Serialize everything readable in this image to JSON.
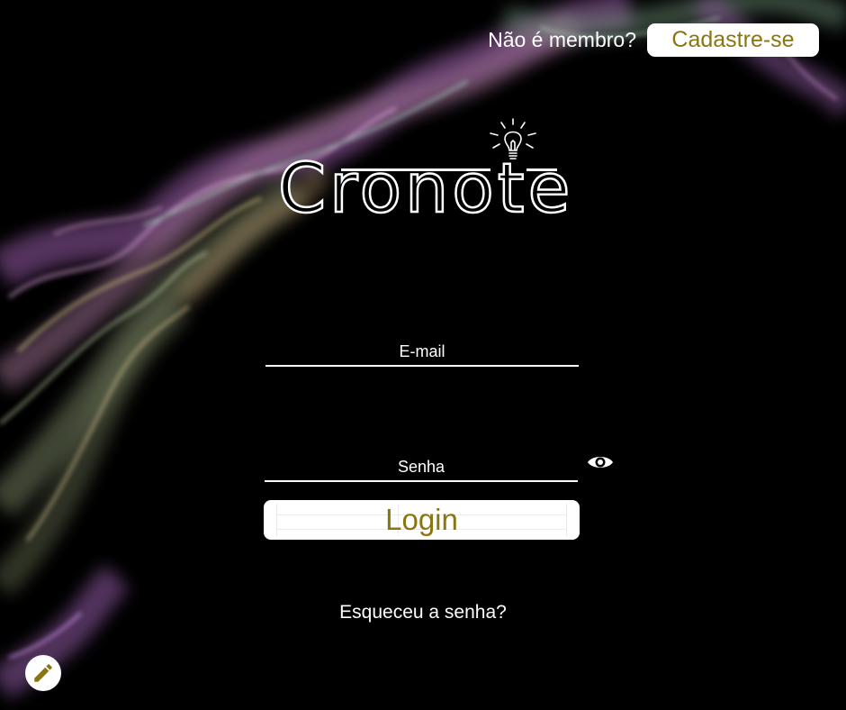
{
  "header": {
    "member_prompt": "Não é membro?",
    "signup_label": "Cadastre-se"
  },
  "logo": {
    "text": "Cronote"
  },
  "form": {
    "email_placeholder": "E-mail",
    "password_placeholder": "Senha",
    "login_label": "Login",
    "forgot_label": "Esqueceu a senha?"
  },
  "icons": {
    "bulb": "lightbulb-icon",
    "eye": "eye-icon",
    "edit": "pencil-icon"
  },
  "colors": {
    "background": "#000000",
    "accent": "#8c7510",
    "text": "#ffffff"
  }
}
